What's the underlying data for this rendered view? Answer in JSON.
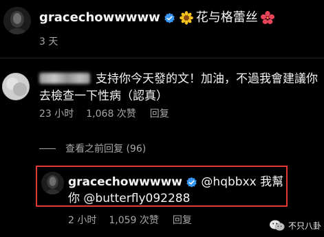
{
  "caption": {
    "username": "gracechowwwww",
    "text": "花与格蕾丝",
    "time": "3 天",
    "leading_emoji": "sunflower-icon",
    "trailing_emoji": "hibiscus-icon"
  },
  "comment": {
    "text": "支持你今天發的文！加油，不過我會建議你去檢查一下性病（認真）",
    "time": "23 小时",
    "likes": "1,068 次赞",
    "reply_label": "回复"
  },
  "view_replies": {
    "label": "查看之前回复 (96)"
  },
  "reply": {
    "username": "gracechowwwww",
    "text": "@hqbbxx 我幫你 @butterfly092288",
    "time": "2 小时",
    "likes": "1,059 次赞",
    "reply_label": "回复"
  },
  "watermark": {
    "text": "不只八卦"
  },
  "colors": {
    "background": "#000000",
    "text": "#f5f5f5",
    "secondary_text": "#a8a8a8",
    "verified_blue": "#3897f0",
    "highlight_red": "#e53935"
  }
}
